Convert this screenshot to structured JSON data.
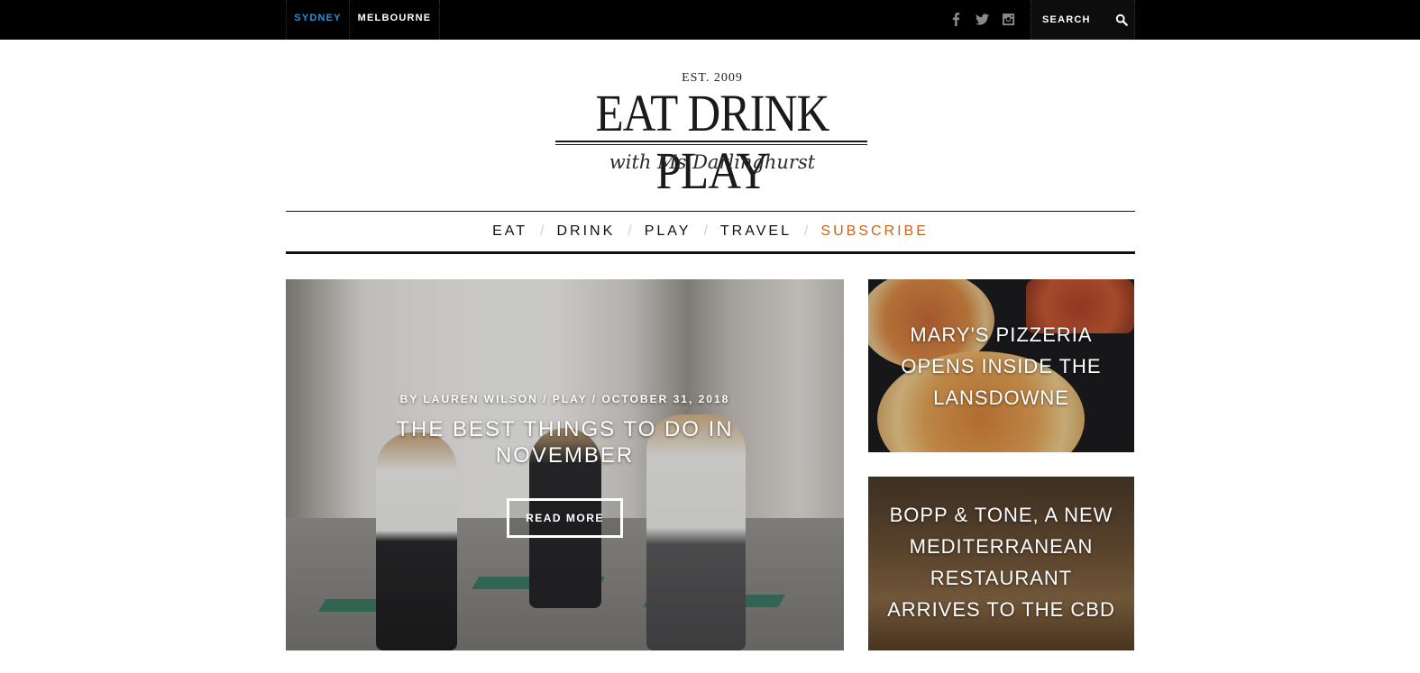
{
  "topbar": {
    "cities": [
      "SYDNEY",
      "MELBOURNE"
    ],
    "social_icons": [
      "facebook-icon",
      "twitter-icon",
      "instagram-icon"
    ],
    "search_placeholder": "SEARCH",
    "accent_color": "#2a8fd8"
  },
  "logo": {
    "est": "EST. 2009",
    "main": "EAT DRINK PLAY",
    "tagline": "with Ms Darlinghurst"
  },
  "nav": {
    "items": [
      "EAT",
      "DRINK",
      "PLAY",
      "TRAVEL",
      "SUBSCRIBE"
    ],
    "separator": "/",
    "subscribe_color": "#c8641b"
  },
  "features": {
    "main": {
      "meta": "BY LAUREN WILSON / PLAY / OCTOBER 31, 2018",
      "title": "THE BEST THINGS TO DO IN NOVEMBER",
      "button": "READ MORE"
    },
    "side": [
      {
        "title": "MARY'S PIZZERIA OPENS INSIDE THE LANSDOWNE"
      },
      {
        "title": "BOPP & TONE, A NEW MEDITERRANEAN RESTAURANT ARRIVES TO THE CBD"
      }
    ]
  }
}
